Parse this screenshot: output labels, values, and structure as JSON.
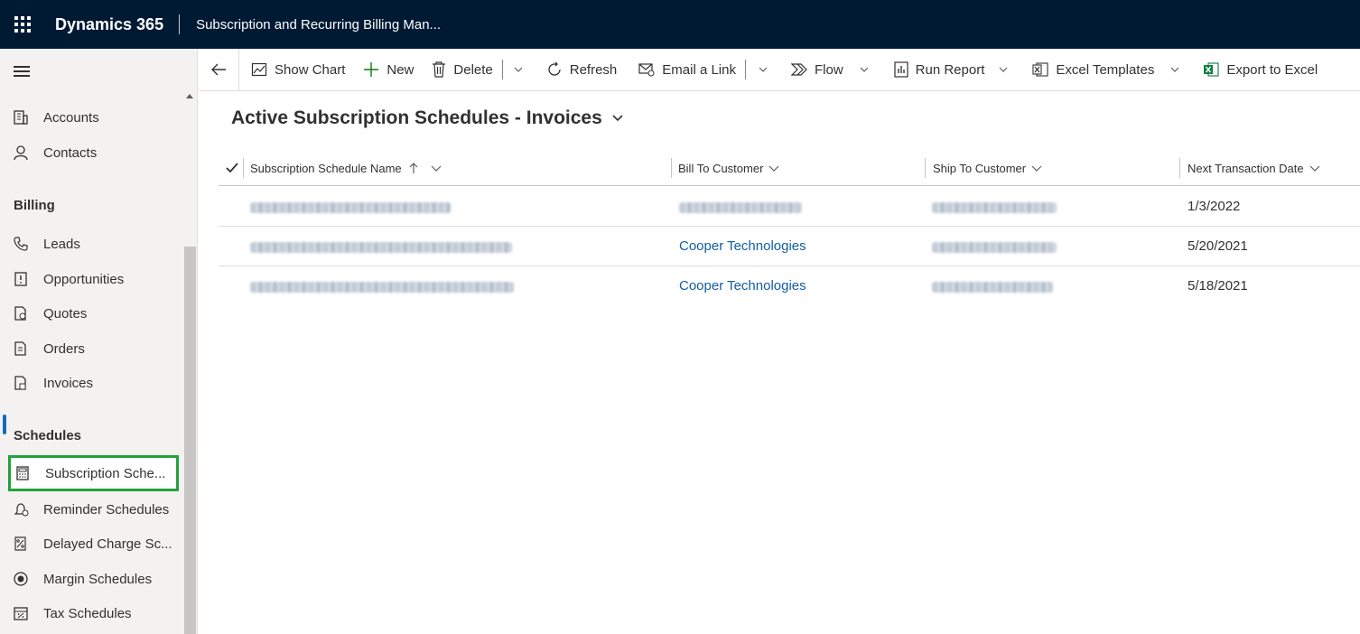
{
  "topbar": {
    "brand": "Dynamics 365",
    "app_name": "Subscription and Recurring Billing Man..."
  },
  "sidebar": {
    "top_items": [
      {
        "label": "Accounts",
        "icon": "building-icon"
      },
      {
        "label": "Contacts",
        "icon": "person-icon"
      }
    ],
    "billing_title": "Billing",
    "billing_items": [
      {
        "label": "Leads",
        "icon": "phone-icon"
      },
      {
        "label": "Opportunities",
        "icon": "opportunity-icon"
      },
      {
        "label": "Quotes",
        "icon": "quote-icon"
      },
      {
        "label": "Orders",
        "icon": "order-icon"
      },
      {
        "label": "Invoices",
        "icon": "invoice-icon"
      }
    ],
    "schedules_title": "Schedules",
    "schedule_items": [
      {
        "label": "Subscription Sche...",
        "icon": "calculator-icon"
      },
      {
        "label": "Reminder Schedules",
        "icon": "reminder-icon"
      },
      {
        "label": "Delayed Charge Sc...",
        "icon": "delayed-charge-icon"
      },
      {
        "label": "Margin Schedules",
        "icon": "margin-icon"
      },
      {
        "label": "Tax Schedules",
        "icon": "tax-calendar-icon"
      }
    ],
    "selected_color": "#22a33a"
  },
  "commands": {
    "show_chart": "Show Chart",
    "new": "New",
    "delete": "Delete",
    "refresh": "Refresh",
    "email_link": "Email a Link",
    "flow": "Flow",
    "run_report": "Run Report",
    "excel_templates": "Excel Templates",
    "export_excel": "Export to Excel"
  },
  "view": {
    "title": "Active Subscription Schedules - Invoices",
    "columns": {
      "name": "Subscription Schedule Name",
      "bill_to": "Bill To Customer",
      "ship_to": "Ship To Customer",
      "next_date": "Next Transaction Date"
    },
    "rows": [
      {
        "bill_to": "",
        "next_date": "1/3/2022"
      },
      {
        "bill_to": "Cooper Technologies",
        "next_date": "5/20/2021"
      },
      {
        "bill_to": "Cooper Technologies",
        "next_date": "5/18/2021"
      }
    ]
  },
  "colors": {
    "topbar": "#001a33",
    "link": "#115ea3",
    "accent": "#0f6cbd"
  }
}
